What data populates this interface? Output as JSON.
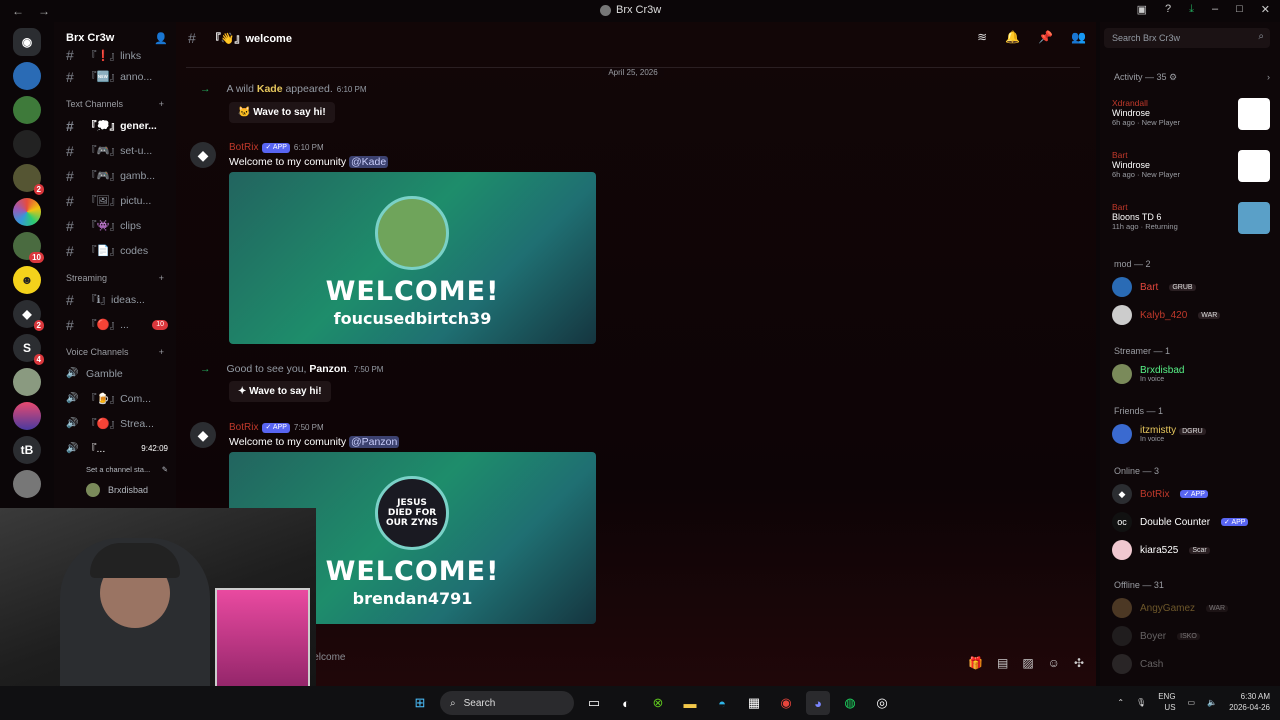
{
  "window": {
    "title": "Brx Cr3w"
  },
  "guild": {
    "name": "Brx Cr3w"
  },
  "channels": {
    "top": [
      {
        "name": "『❗』links"
      },
      {
        "name": "『🆕』anno..."
      }
    ],
    "categories": [
      {
        "name": "Text Channels",
        "items": [
          {
            "name": "『💭』gener...",
            "active": true
          },
          {
            "name": "『🎮』set-u..."
          },
          {
            "name": "『🎮』gamb..."
          },
          {
            "name": "『🖼』pictu..."
          },
          {
            "name": "『👾』clips"
          },
          {
            "name": "『📄』codes"
          }
        ]
      },
      {
        "name": "Streaming",
        "items": [
          {
            "name": "『ℹ』ideas..."
          },
          {
            "name": "『🔴』...",
            "badge": "10"
          }
        ]
      },
      {
        "name": "Voice Channels",
        "items": [
          {
            "name": "Gamble"
          },
          {
            "name": "『🍺』Com..."
          },
          {
            "name": "『🔴』Strea..."
          },
          {
            "name": "『...",
            "time": "9:42:09"
          }
        ]
      }
    ],
    "status_placeholder": "Set a channel sta...",
    "voice_user": "Brxdisbad"
  },
  "main": {
    "channel": "『👋』welcome",
    "date": "April 25, 2026",
    "events": [
      {
        "pre": "A wild ",
        "user": "Kade",
        "post": " appeared.",
        "time": "6:10 PM",
        "wave": "Wave to say hi!"
      },
      {
        "pre": "Good to see you, ",
        "user": "Panzon",
        "post": ".",
        "time": "7:50 PM",
        "wave": "Wave to say hi!"
      }
    ],
    "messages": [
      {
        "author": "BotRix",
        "tag": "✓ APP",
        "time": "6:10 PM",
        "text": "Welcome to my comunity ",
        "mention": "@Kade",
        "card_title": "WELCOME!",
        "card_user": "foucusedbirtch39"
      },
      {
        "author": "BotRix",
        "tag": "✓ APP",
        "time": "7:50 PM",
        "text": "Welcome to my comunity ",
        "mention": "@Panzon",
        "card_title": "WELCOME!",
        "card_user": "brendan4791",
        "avatar_text": "JESUS DIED FOR OUR ZYNS"
      }
    ],
    "composer": "welcome"
  },
  "members": {
    "search": "Search Brx Cr3w",
    "activity_header": "Activity — 35",
    "activity": [
      {
        "name": "Xdrandall",
        "game": "Windrose",
        "ago": "6h ago",
        "status": "New Player"
      },
      {
        "name": "Bart",
        "game": "Windrose",
        "ago": "6h ago",
        "status": "New Player"
      },
      {
        "name": "Bart",
        "game": "Bloons TD 6",
        "ago": "11h ago",
        "status": "Returning"
      }
    ],
    "groups": [
      {
        "header": "mod — 2",
        "members": [
          {
            "name": "Bart",
            "tag": "GRUB",
            "color": "#e0463c"
          },
          {
            "name": "Kalyb_420",
            "tag": "WAR",
            "color": "#c0392b"
          }
        ]
      },
      {
        "header": "Streamer — 1",
        "members": [
          {
            "name": "Brxdisbad",
            "status": "In voice",
            "color": "#57f287"
          }
        ]
      },
      {
        "header": "Friends — 1",
        "members": [
          {
            "name": "itzmistty",
            "tag": "DGRU",
            "status": "In voice",
            "color": "#e6c75d"
          }
        ]
      },
      {
        "header": "Online — 3",
        "members": [
          {
            "name": "BotRix",
            "tag": "✓ APP",
            "color": "#c0392b"
          },
          {
            "name": "Double Counter",
            "tag": "✓ APP",
            "color": "#ffffff"
          },
          {
            "name": "kiara525",
            "tag": "Scar",
            "color": "#ffffff"
          }
        ]
      },
      {
        "header": "Offline — 31",
        "members": [
          {
            "name": "AngyGamez",
            "tag": "WAR",
            "color": "#7a6a40"
          },
          {
            "name": "Boyer",
            "tag": "ISKO",
            "color": "#6d6f78"
          },
          {
            "name": "Cash",
            "color": "#6d6f78"
          }
        ]
      }
    ]
  },
  "taskbar": {
    "search": "Search",
    "lang": "ENG",
    "region": "US",
    "time": "6:30 AM",
    "date": "2026-04-26"
  }
}
